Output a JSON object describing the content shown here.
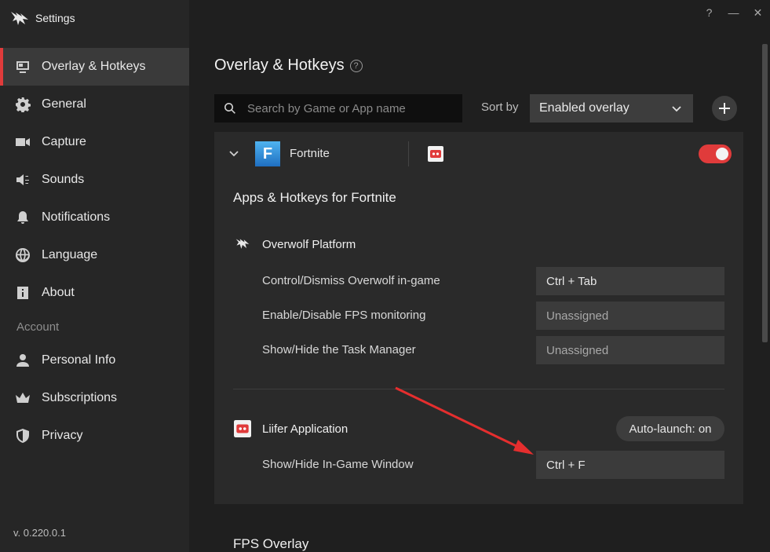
{
  "window": {
    "title": "Settings",
    "controls": {
      "help": "?",
      "minimize": "—",
      "close": "✕"
    }
  },
  "sidebar": {
    "items": [
      {
        "label": "Overlay & Hotkeys",
        "icon": "overlay-icon",
        "active": true
      },
      {
        "label": "General",
        "icon": "gear-icon"
      },
      {
        "label": "Capture",
        "icon": "camera-icon"
      },
      {
        "label": "Sounds",
        "icon": "speaker-icon"
      },
      {
        "label": "Notifications",
        "icon": "bell-icon"
      },
      {
        "label": "Language",
        "icon": "globe-icon"
      },
      {
        "label": "About",
        "icon": "info-icon"
      }
    ],
    "account_heading": "Account",
    "account_items": [
      {
        "label": "Personal Info",
        "icon": "person-icon"
      },
      {
        "label": "Subscriptions",
        "icon": "crown-icon"
      },
      {
        "label": "Privacy",
        "icon": "shield-icon"
      }
    ],
    "version": "v. 0.220.0.1"
  },
  "main": {
    "title": "Overlay & Hotkeys",
    "help_glyph": "?",
    "search": {
      "placeholder": "Search by Game or App name",
      "value": ""
    },
    "sort": {
      "label": "Sort by",
      "selected": "Enabled overlay"
    },
    "game": {
      "logo_letter": "F",
      "name": "Fortnite",
      "overlay_enabled": true,
      "section_title": "Apps & Hotkeys for Fortnite",
      "groups": [
        {
          "name": "Overwolf Platform",
          "icon": "overwolf-icon",
          "hotkeys": [
            {
              "label": "Control/Dismiss Overwolf in-game",
              "value": "Ctrl + Tab"
            },
            {
              "label": "Enable/Disable FPS monitoring",
              "value": "Unassigned"
            },
            {
              "label": "Show/Hide the Task Manager",
              "value": "Unassigned"
            }
          ]
        },
        {
          "name": "Liifer Application",
          "icon": "liifer-app-icon",
          "autolaunch": "Auto-launch: on",
          "hotkeys": [
            {
              "label": "Show/Hide In-Game Window",
              "value": "Ctrl + F"
            }
          ]
        }
      ]
    },
    "next_section": "FPS Overlay"
  },
  "colors": {
    "accent": "#e03b3b",
    "background": "#1f1f1f",
    "sidebar": "#262626",
    "panel": "#2a2a2a"
  }
}
